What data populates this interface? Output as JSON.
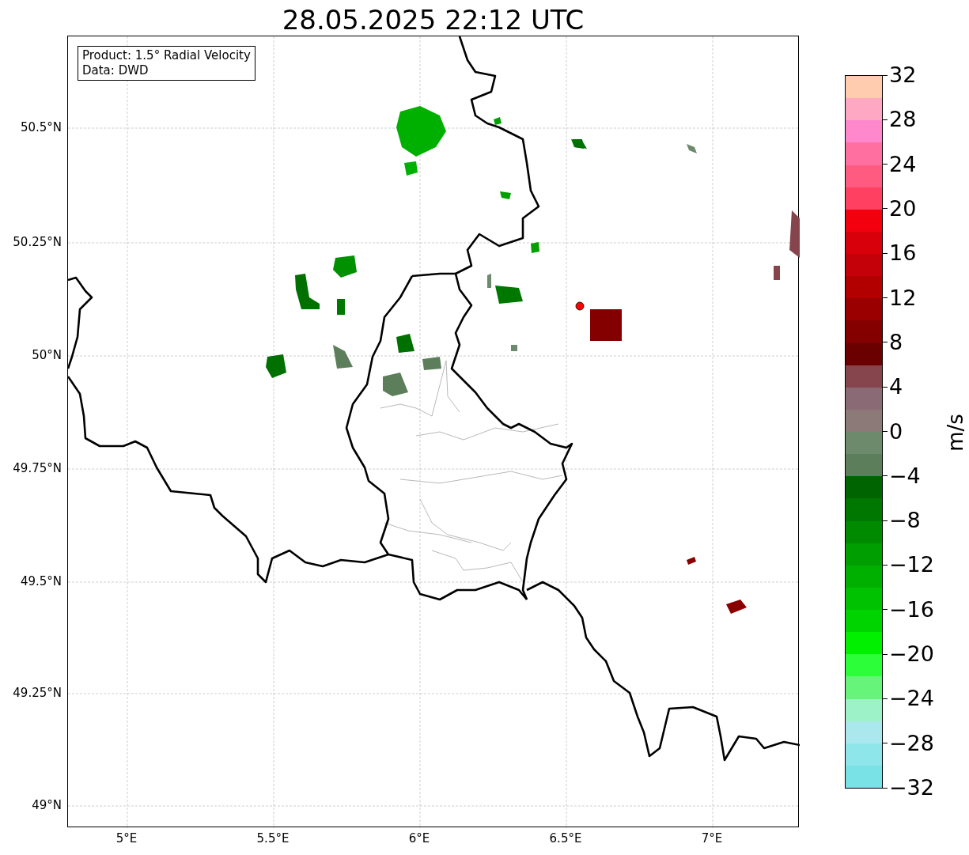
{
  "title": "28.05.2025 22:12 UTC",
  "info_box": {
    "lines": [
      "Product: 1.5° Radial Velocity",
      "Data: DWD"
    ]
  },
  "map": {
    "lat_labels": [
      "50.5°N",
      "50.25°N",
      "50°N",
      "49.75°N",
      "49.5°N",
      "49.25°N",
      "49°N"
    ],
    "lon_labels": [
      "5°E",
      "5.5°E",
      "6°E",
      "6.5°E",
      "7°E"
    ]
  },
  "colorbar": {
    "label": "m/s",
    "ticks": [
      "32",
      "28",
      "24",
      "20",
      "16",
      "12",
      "8",
      "4",
      "0",
      "−4",
      "−8",
      "−12",
      "−16",
      "−20",
      "−24",
      "−28",
      "−32"
    ],
    "segments": [
      {
        "color": "#ffccb0"
      },
      {
        "color": "#ffa8c4"
      },
      {
        "color": "#ff88cc"
      },
      {
        "color": "#ff70a0"
      },
      {
        "color": "#ff5a80"
      },
      {
        "color": "#ff4060"
      },
      {
        "color": "#f2000e"
      },
      {
        "color": "#d8000a"
      },
      {
        "color": "#c40008"
      },
      {
        "color": "#b20000"
      },
      {
        "color": "#9a0000"
      },
      {
        "color": "#840000"
      },
      {
        "color": "#6a0000"
      },
      {
        "color": "#86454c"
      },
      {
        "color": "#8a6a74"
      },
      {
        "color": "#8c7a78"
      },
      {
        "color": "#6d8a6c"
      },
      {
        "color": "#5c7e5a"
      },
      {
        "color": "#006400"
      },
      {
        "color": "#007800"
      },
      {
        "color": "#008a00"
      },
      {
        "color": "#009e00"
      },
      {
        "color": "#00b000"
      },
      {
        "color": "#00c200"
      },
      {
        "color": "#00d400"
      },
      {
        "color": "#00f000"
      },
      {
        "color": "#2cff3a"
      },
      {
        "color": "#66f57a"
      },
      {
        "color": "#9ef2c8"
      },
      {
        "color": "#aae8ee"
      },
      {
        "color": "#8ee6ea"
      },
      {
        "color": "#78e2e6"
      }
    ]
  }
}
